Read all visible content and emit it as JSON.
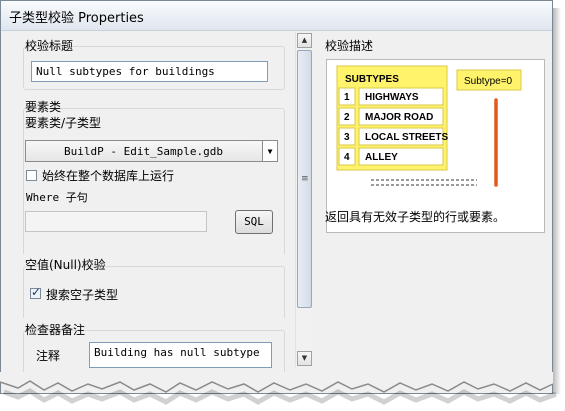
{
  "window": {
    "title": "子类型校验 Properties"
  },
  "check_title": {
    "group_label": "校验标题",
    "value": "Null subtypes for buildings"
  },
  "feature_class": {
    "group_label": "要素类",
    "field_label": "要素类/子类型",
    "selected": "BuildP - Edit_Sample.gdb",
    "run_on_full_db_label": "始终在整个数据库上运行",
    "run_on_full_db_checked": false,
    "where_label": "Where 子句",
    "where_value": "",
    "sql_button": "SQL"
  },
  "null_check": {
    "group_label": "空值(Null)校验",
    "search_empty_label": "搜索空子类型",
    "search_empty_checked": true
  },
  "reviewer_remarks": {
    "group_label": "检查器备注",
    "notes_label": "注释",
    "notes_value": "Building has null subtype"
  },
  "description": {
    "group_label": "校验描述",
    "text": "返回具有无效子类型的行或要素。",
    "diagram": {
      "header": "SUBTYPES",
      "rows": [
        {
          "num": "1",
          "name": "HIGHWAYS"
        },
        {
          "num": "2",
          "name": "MAJOR ROAD"
        },
        {
          "num": "3",
          "name": "LOCAL STREETS"
        },
        {
          "num": "4",
          "name": "ALLEY"
        }
      ],
      "callout": "Subtype=0",
      "colors": {
        "table_fill": "#fff36b",
        "table_border": "#d8c84a",
        "line": "#e35a1c"
      }
    }
  }
}
